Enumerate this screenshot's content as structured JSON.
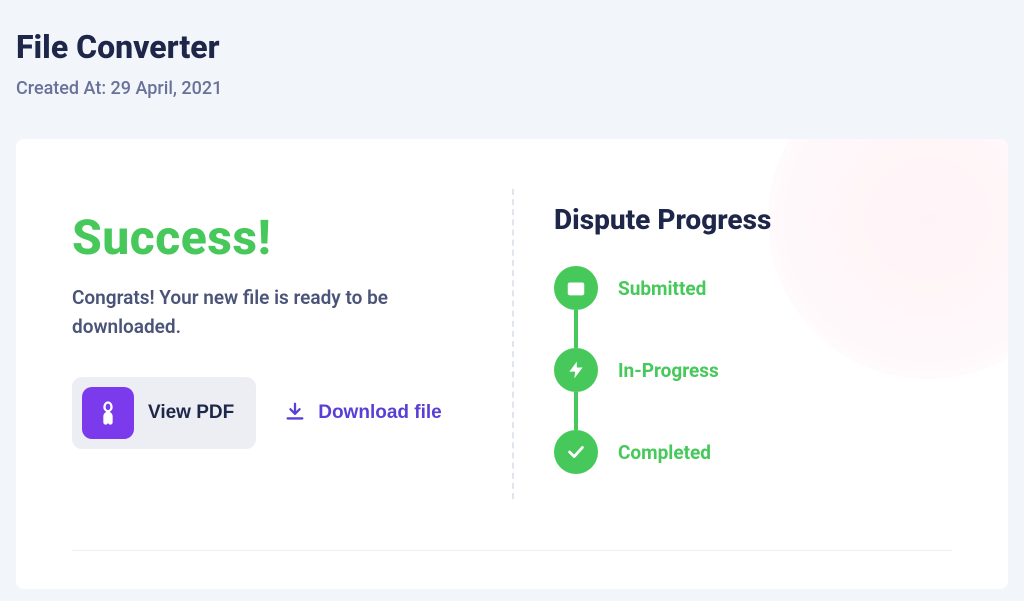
{
  "header": {
    "title": "File Converter",
    "created_at": "Created At: 29 April, 2021"
  },
  "success": {
    "title": "Success!",
    "message": "Congrats! Your new file is ready to be downloaded.",
    "view_pdf_label": "View PDF",
    "download_label": "Download file"
  },
  "progress": {
    "title": "Dispute Progress",
    "steps": [
      {
        "label": "Submitted"
      },
      {
        "label": "In-Progress"
      },
      {
        "label": "Completed"
      }
    ]
  }
}
